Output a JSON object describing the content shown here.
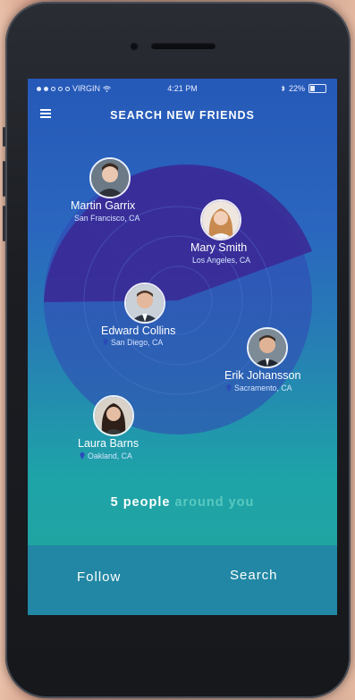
{
  "status_bar": {
    "carrier": "VIRGIN",
    "time": "4:21 PM",
    "battery": "22%"
  },
  "nav": {
    "title": "SEARCH NEW FRIENDS",
    "menu_icon": "hamburger-menu-icon"
  },
  "people": [
    {
      "name": "Martin Garrix",
      "location": "San Francisco, CA",
      "has_pin": false
    },
    {
      "name": "Mary Smith",
      "location": "Los Angeles, CA",
      "has_pin": false
    },
    {
      "name": "Edward Collins",
      "location": "San Diego, CA",
      "has_pin": true
    },
    {
      "name": "Erik Johansson",
      "location": "Sacramento, CA",
      "has_pin": true
    },
    {
      "name": "Laura Barns",
      "location": "Oakland, CA",
      "has_pin": true
    }
  ],
  "summary": {
    "count": "5",
    "word": "people",
    "rest": "around you"
  },
  "actions": {
    "follow": "Follow",
    "search": "Search"
  },
  "colors": {
    "screen_top": "#2659b8",
    "screen_bottom": "#22a49c",
    "radar_sector": "#3b2a96",
    "bottom_bar": "#2187a4",
    "accent_text": "#58c9c0"
  }
}
